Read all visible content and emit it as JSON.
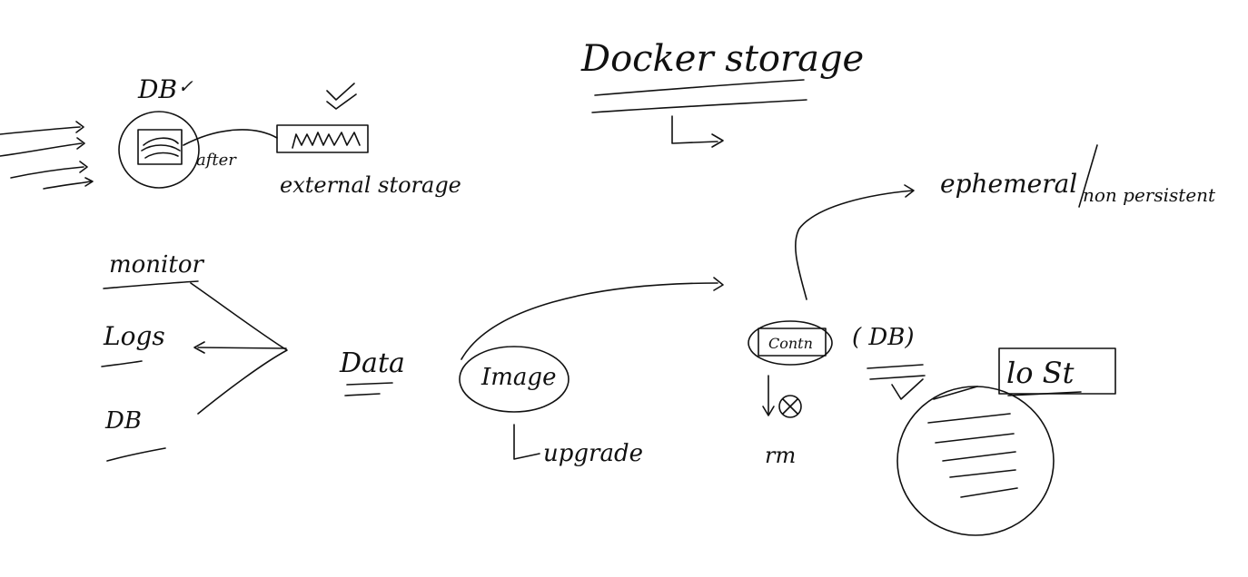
{
  "colors": {
    "ink": "#111111",
    "paper": "#ffffff"
  },
  "labels": {
    "title": "Docker storage",
    "db_top": "DB",
    "db_check": "✓",
    "after": "after",
    "external": "external storage",
    "ephemeral": "ephemeral",
    "non_persistent": "non persistent",
    "monitor": "monitor",
    "logs": "Logs",
    "db_left": "DB",
    "data": "Data",
    "image": "Image",
    "upgrade": "upgrade",
    "container": "Contn",
    "db_paren": "( DB)",
    "lost": "lo St",
    "rm": "rm"
  }
}
